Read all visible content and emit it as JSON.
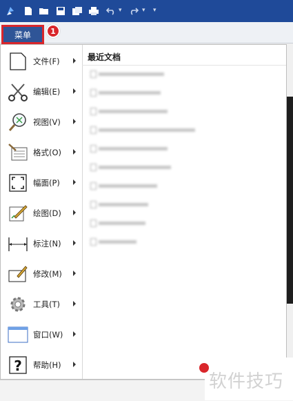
{
  "menu": {
    "button_label": "菜单",
    "step_badge": "1",
    "items": [
      {
        "label": "文件(F)",
        "icon": "blank-document-icon"
      },
      {
        "label": "编辑(E)",
        "icon": "scissors-icon"
      },
      {
        "label": "视图(V)",
        "icon": "magnifier-icon"
      },
      {
        "label": "格式(O)",
        "icon": "format-icon"
      },
      {
        "label": "幅面(P)",
        "icon": "page-frame-icon"
      },
      {
        "label": "绘图(D)",
        "icon": "pencil-draw-icon"
      },
      {
        "label": "标注(N)",
        "icon": "dimension-icon"
      },
      {
        "label": "修改(M)",
        "icon": "modify-icon"
      },
      {
        "label": "工具(T)",
        "icon": "gear-icon"
      },
      {
        "label": "窗口(W)",
        "icon": "window-icon"
      },
      {
        "label": "帮助(H)",
        "icon": "help-icon"
      }
    ]
  },
  "recent": {
    "title": "最近文档"
  },
  "watermark": {
    "text": "软件技巧"
  }
}
